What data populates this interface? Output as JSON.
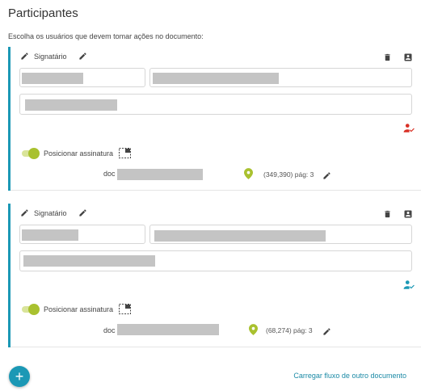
{
  "page": {
    "title": "Participantes",
    "subtitle": "Escolha os usuários que devem tomar ações no documento:"
  },
  "participants": [
    {
      "role_label": "Signatário",
      "position_toggle_label": "Posicionar assinatura",
      "position_toggle_on": true,
      "doc_prefix": "doc",
      "coordinates_text": "(349,390) pág: 3",
      "status_icon_color": "#d93025"
    },
    {
      "role_label": "Signatário",
      "position_toggle_label": "Posicionar assinatura",
      "position_toggle_on": true,
      "doc_prefix": "doc",
      "coordinates_text": "(68,274) pág: 3",
      "status_icon_color": "#1b98b5"
    }
  ],
  "footer": {
    "add_button_label": "+",
    "load_flow_link": "Carregar fluxo de outro documento"
  },
  "colors": {
    "accent": "#1b98b5",
    "toggle_on": "#a9c12f",
    "redacted": "#c4c4c4"
  }
}
